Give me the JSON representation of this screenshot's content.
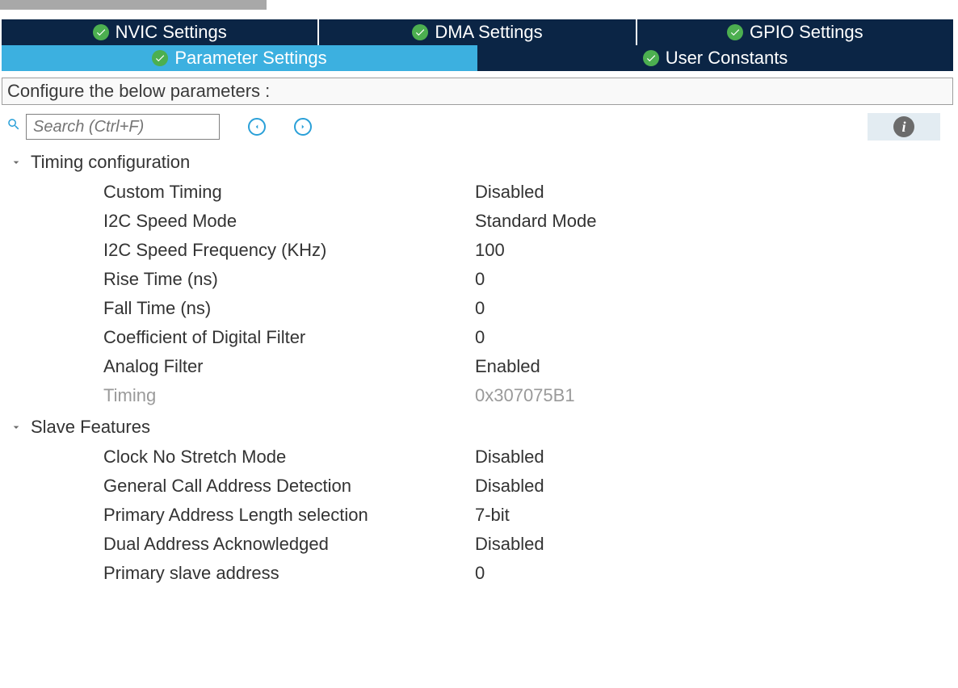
{
  "tabs_row1": [
    {
      "label": "NVIC Settings"
    },
    {
      "label": "DMA Settings"
    },
    {
      "label": "GPIO Settings"
    }
  ],
  "tabs_row2": [
    {
      "label": "Parameter Settings",
      "active": true
    },
    {
      "label": "User Constants",
      "active": false
    }
  ],
  "configure_label": "Configure the below parameters :",
  "search": {
    "placeholder": "Search (Ctrl+F)"
  },
  "groups": [
    {
      "title": "Timing configuration",
      "rows": [
        {
          "label": "Custom Timing",
          "value": "Disabled",
          "dim": false
        },
        {
          "label": "I2C Speed Mode",
          "value": "Standard Mode",
          "dim": false
        },
        {
          "label": "I2C Speed Frequency (KHz)",
          "value": "100",
          "dim": false
        },
        {
          "label": "Rise Time (ns)",
          "value": "0",
          "dim": false
        },
        {
          "label": "Fall Time (ns)",
          "value": "0",
          "dim": false
        },
        {
          "label": "Coefficient of Digital Filter",
          "value": "0",
          "dim": false
        },
        {
          "label": "Analog Filter",
          "value": "Enabled",
          "dim": false
        },
        {
          "label": "Timing",
          "value": "0x307075B1",
          "dim": true
        }
      ]
    },
    {
      "title": "Slave Features",
      "rows": [
        {
          "label": "Clock No Stretch Mode",
          "value": "Disabled",
          "dim": false
        },
        {
          "label": "General Call Address Detection",
          "value": "Disabled",
          "dim": false
        },
        {
          "label": "Primary Address Length selection",
          "value": "7-bit",
          "dim": false
        },
        {
          "label": "Dual Address Acknowledged",
          "value": "Disabled",
          "dim": false
        },
        {
          "label": "Primary slave address",
          "value": "0",
          "dim": false
        }
      ]
    }
  ]
}
